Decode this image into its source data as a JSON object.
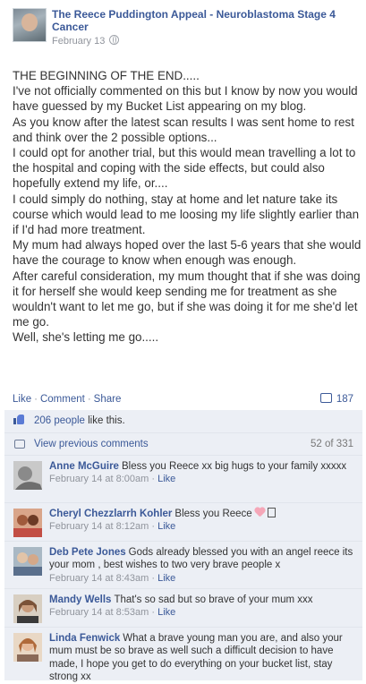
{
  "post": {
    "page_name": "The Reece Puddington Appeal - Neuroblastoma Stage 4 Cancer",
    "date": "February 13",
    "privacy_icon": "globe-icon",
    "body": [
      "THE BEGINNING OF THE END.....",
      "I've not officially commented on this but I know by now you would have guessed by my Bucket List appearing on my blog.",
      "As you know after the latest scan results I was sent home to rest and think over the 2 possible options...",
      "I could opt for another trial, but this would mean travelling a lot to the hospital and coping with the side effects, but could also hopefully extend my life, or....",
      "I could simply do nothing, stay at home and let nature take its course which would lead to me loosing my life slightly earlier than if I'd had more treatment.",
      "My mum had always hoped over the last 5-6 years that she would have the courage to know when enough was enough.",
      "After careful consideration, my mum thought that if she was doing it for herself she would keep sending me for treatment as she wouldn't want to let me go, but if she was doing it for me she'd let me go.",
      "Well, she's letting me go....."
    ]
  },
  "actions": {
    "like": "Like",
    "comment": "Comment",
    "share": "Share",
    "separator": "·",
    "comment_count": "187"
  },
  "likes": {
    "count_text": "206 people",
    "suffix": " like this."
  },
  "previous": {
    "label": "View previous comments",
    "count": "52 of 331"
  },
  "comments": [
    {
      "author": "Anne McGuire",
      "text": "Bless you Reece xx big hugs to your family xxxxx",
      "time": "February 14 at 8:00am",
      "like": "Like"
    },
    {
      "author": "Cheryl Chezzlarrh Kohler",
      "text": "Bless you Reece",
      "time": "February 14 at 8:12am",
      "like": "Like"
    },
    {
      "author": "Deb Pete Jones",
      "text": "Gods already blessed you with an angel reece its your mom , best wishes to two very brave people x",
      "time": "February 14 at 8:43am",
      "like": "Like"
    },
    {
      "author": "Mandy Wells",
      "text": "That's so sad but so brave of your mum xxx",
      "time": "February 14 at 8:53am",
      "like": "Like"
    },
    {
      "author": "Linda Fenwick",
      "text": "What a brave young man you are, and also your mum must be so brave as well such a difficult decision to have made, I hope you get to do everything on your bucket list, stay strong xx",
      "time": "",
      "like": ""
    }
  ],
  "colors": {
    "link": "#3b5998",
    "ufi_background": "#eceff5",
    "meta_text": "#90949c"
  }
}
